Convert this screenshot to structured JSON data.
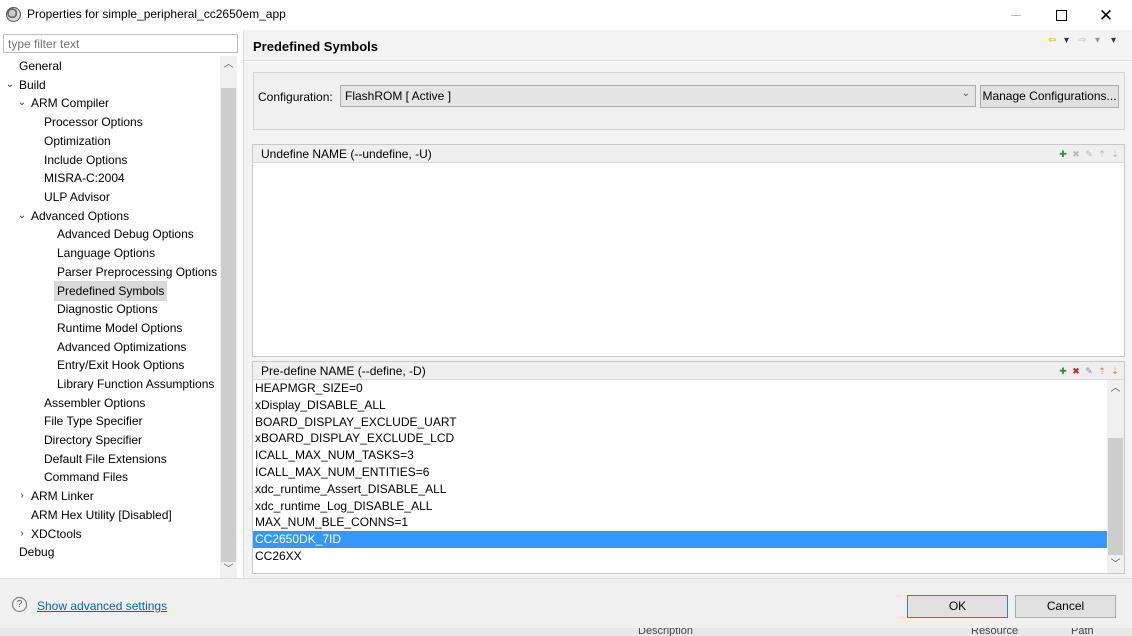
{
  "window": {
    "title": "Properties for simple_peripheral_cc2650em_app"
  },
  "filter": {
    "placeholder": "type filter text"
  },
  "tree": {
    "items": [
      {
        "label": "General",
        "twisty": ""
      },
      {
        "label": "Build",
        "twisty": "⌄"
      },
      {
        "label": "ARM Compiler",
        "twisty": "⌄"
      },
      {
        "label": "Processor Options",
        "twisty": ""
      },
      {
        "label": "Optimization",
        "twisty": ""
      },
      {
        "label": "Include Options",
        "twisty": ""
      },
      {
        "label": "MISRA-C:2004",
        "twisty": ""
      },
      {
        "label": "ULP Advisor",
        "twisty": ""
      },
      {
        "label": "Advanced Options",
        "twisty": "⌄"
      },
      {
        "label": "Advanced Debug Options",
        "twisty": ""
      },
      {
        "label": "Language Options",
        "twisty": ""
      },
      {
        "label": "Parser Preprocessing Options",
        "twisty": ""
      },
      {
        "label": "Predefined Symbols",
        "twisty": ""
      },
      {
        "label": "Diagnostic Options",
        "twisty": ""
      },
      {
        "label": "Runtime Model Options",
        "twisty": ""
      },
      {
        "label": "Advanced Optimizations",
        "twisty": ""
      },
      {
        "label": "Entry/Exit Hook Options",
        "twisty": ""
      },
      {
        "label": "Library Function Assumptions",
        "twisty": ""
      },
      {
        "label": "Assembler Options",
        "twisty": ""
      },
      {
        "label": "File Type Specifier",
        "twisty": ""
      },
      {
        "label": "Directory Specifier",
        "twisty": ""
      },
      {
        "label": "Default File Extensions",
        "twisty": ""
      },
      {
        "label": "Command Files",
        "twisty": ""
      },
      {
        "label": "ARM Linker",
        "twisty": "›"
      },
      {
        "label": "ARM Hex Utility  [Disabled]",
        "twisty": ""
      },
      {
        "label": "XDCtools",
        "twisty": "›"
      },
      {
        "label": "Debug",
        "twisty": ""
      }
    ]
  },
  "page": {
    "title": "Predefined Symbols",
    "config_label": "Configuration:",
    "config_value": "FlashROM  [ Active ]",
    "manage_button": "Manage Configurations..."
  },
  "undefine_panel": {
    "header": "Undefine NAME (--undefine, -U)",
    "items": []
  },
  "predefine_panel": {
    "header": "Pre-define NAME (--define, -D)",
    "items": [
      "HEAPMGR_SIZE=0",
      "xDisplay_DISABLE_ALL",
      "BOARD_DISPLAY_EXCLUDE_UART",
      "xBOARD_DISPLAY_EXCLUDE_LCD",
      "ICALL_MAX_NUM_TASKS=3",
      "ICALL_MAX_NUM_ENTITIES=6",
      "xdc_runtime_Assert_DISABLE_ALL",
      "xdc_runtime_Log_DISABLE_ALL",
      "MAX_NUM_BLE_CONNS=1",
      "CC2650DK_7ID",
      "CC26XX"
    ],
    "selected": "CC2650DK_7ID"
  },
  "footer": {
    "help_icon": "question-icon",
    "advanced_link": "Show advanced settings",
    "ok": "OK",
    "cancel": "Cancel"
  },
  "background_strip": {
    "description_col": "Description",
    "resource_col": "Resource",
    "path_col": "Path"
  },
  "colors": {
    "selection": "#3399ff",
    "link": "#0b5fb5",
    "ok_border": "#3b79d6"
  }
}
